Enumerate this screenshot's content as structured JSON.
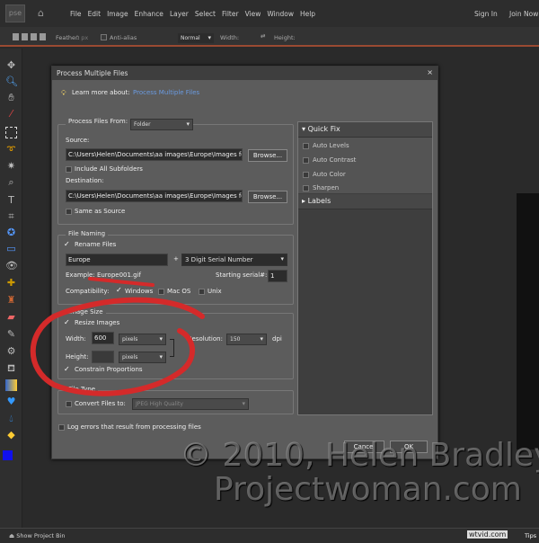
{
  "app": {
    "logo": "pse",
    "menu": [
      "File",
      "Edit",
      "Image",
      "Enhance",
      "Layer",
      "Select",
      "Filter",
      "View",
      "Window",
      "Help"
    ],
    "sign_in": "Sign In",
    "join_now": "Join Now"
  },
  "options": {
    "feather_label": "Feather:",
    "feather_value": "0 px",
    "anti_alias": "Anti-alias",
    "mode": "Normal",
    "width_label": "Width:",
    "height_label": "Height:"
  },
  "dialog": {
    "title": "Process Multiple Files",
    "learn_more": "Learn more about:",
    "learn_link": "Process Multiple Files",
    "process_from_label": "Process Files From:",
    "process_from_value": "Folder",
    "source_label": "Source:",
    "source_value": "C:\\Users\\Helen\\Documents\\aa images\\Europe\\Images fo",
    "browse": "Browse...",
    "include_subfolders": "Include All Subfolders",
    "destination_label": "Destination:",
    "destination_value": "C:\\Users\\Helen\\Documents\\aa images\\Europe\\Images fo",
    "same_as_source": "Same as Source",
    "file_naming": "File Naming",
    "rename_files": "Rename Files",
    "rename_files_checked": true,
    "name_value": "Europe",
    "plus": "+",
    "serial_value": "3 Digit Serial Number",
    "example": "Example: Europe001.gif",
    "starting_serial_label": "Starting serial#:",
    "starting_serial_value": "1",
    "compatibility_label": "Compatibility:",
    "windows": "Windows",
    "mac_os": "Mac OS",
    "unix": "Unix",
    "image_size": "Image Size",
    "resize_images": "Resize Images",
    "resize_checked": true,
    "width_label": "Width:",
    "width_value": "600",
    "width_unit": "pixels",
    "height_label": "Height:",
    "height_value": "",
    "height_unit": "pixels",
    "resolution_label": "Resolution:",
    "resolution_value": "150",
    "dpi": "dpi",
    "constrain": "Constrain Proportions",
    "constrain_checked": true,
    "file_type": "File Type",
    "convert_files": "Convert Files to:",
    "convert_value": "JPEG High Quality",
    "log_errors": "Log errors that result from processing files",
    "cancel": "Cancel",
    "ok": "OK",
    "panel": {
      "quick_fix": "Quick Fix",
      "items": [
        "Auto Levels",
        "Auto Contrast",
        "Auto Color",
        "Sharpen"
      ],
      "labels": "Labels"
    }
  },
  "status": {
    "project_bin": "Show Project Bin",
    "tips": "Tips",
    "site": "wtvid.com"
  },
  "watermark": {
    "line1": "© 2010, Helen Bradley",
    "line2": "Projectwoman.com"
  },
  "colors": {
    "annotation": "#d42a2a",
    "accent_line": "#9a4a32",
    "link": "#6a9ae0",
    "foreground": "#1010ee",
    "background": "#ffffff"
  }
}
